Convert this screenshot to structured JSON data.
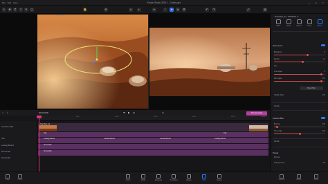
{
  "titlebar": {
    "title": "Fusion Studio 2024.1 - Crash.ppro",
    "menu": [
      "File",
      "Edit",
      "View"
    ],
    "window_controls": "— ▢ ✕"
  },
  "viewer": {
    "label": "Viewer A1"
  },
  "inspector": {
    "clip_name": "OverView_A1 · 00:00:05 · ▾",
    "tabs": [
      {
        "label": "Video",
        "active": false
      },
      {
        "label": "Audio",
        "active": false
      },
      {
        "label": "Speed",
        "active": false
      },
      {
        "label": "Color",
        "active": false
      },
      {
        "label": "Effects",
        "active": true
      }
    ],
    "section_lens": "Zoom Lens",
    "props1": [
      {
        "label": "Brightness",
        "value": "0",
        "fill": 0.65
      },
      {
        "label": "Radius",
        "value": "1.4",
        "fill": 0.55
      },
      {
        "label": "Hue",
        "value": "",
        "fill": 0
      },
      {
        "label": "Low edges",
        "value": "0",
        "fill": 0.92
      },
      {
        "label": "Ref edges",
        "value": "0.10",
        "fill": 0.92
      }
    ],
    "reset_button": "Reset filter",
    "height_label": "Height offset",
    "height_value": "0.00",
    "details1": "Details",
    "section_color": "Colorize Blur",
    "props2": [
      {
        "label": "Blurring",
        "value": "0.00",
        "fill": 0.06
      },
      {
        "label": "Hue Angle",
        "value": "0.00",
        "fill": 0.5
      }
    ],
    "details2": "Details",
    "section_preset": "Preset",
    "preset_value": "Normal",
    "timing_label": "Transparency",
    "timing_value": "0%"
  },
  "timeline": {
    "timecode": "00:00:03:08",
    "zoom": "Fit",
    "render_button": "Preview render",
    "ruler_ticks": [
      "0:00",
      "00:5",
      "00:10",
      "00:15",
      "00:20",
      "00:25",
      "00:30"
    ],
    "tracks": [
      {
        "name": "Overview Clips"
      },
      {
        "name": "Title"
      },
      {
        "name": "Looking Behind"
      },
      {
        "name": "Normal title"
      },
      {
        "name": "Normal title"
      }
    ],
    "clips": {
      "video_start": "OverView_A1",
      "video_end": "Fade",
      "title_a": "Title",
      "title_b": "Title",
      "looking": [
        "Looking Behind",
        "Looking Behind",
        "Looking Behind",
        "Looking Behind"
      ],
      "normal1": "Normal title",
      "normal2": "Normal title"
    },
    "colors": {
      "video": "#3a2a3e",
      "purple": "#5a2f61",
      "header_pink": "#b83fa0",
      "playhead": "#e0307a"
    }
  },
  "bottom_nav": {
    "items": [
      {
        "label": "Import",
        "active": false
      },
      {
        "label": "Media",
        "active": false
      },
      {
        "label": "Elements",
        "active": false
      },
      {
        "label": "Transitions",
        "active": false
      },
      {
        "label": "Effects",
        "active": false
      },
      {
        "label": "Titles",
        "active": true
      },
      {
        "label": "Export",
        "active": false
      }
    ],
    "left_items": [
      "Project",
      "Library"
    ],
    "right_items": [
      "Inspector",
      "Effects",
      "Export"
    ]
  },
  "accent_color": "#2f7bff"
}
